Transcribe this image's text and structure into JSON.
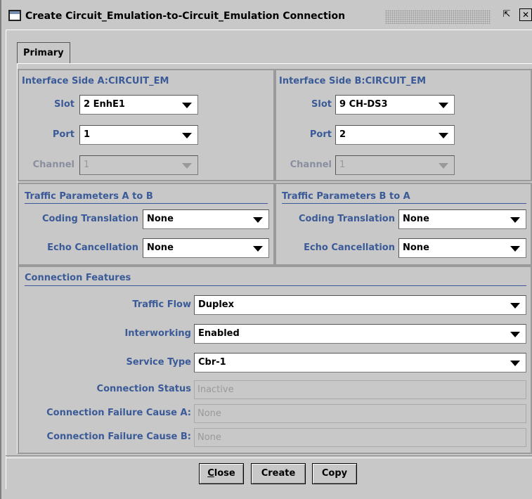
{
  "window": {
    "title": "Create Circuit_Emulation-to-Circuit_Emulation Connection"
  },
  "tabs": [
    {
      "label": "Primary"
    }
  ],
  "side_a": {
    "title": "Interface Side A:CIRCUIT_EM",
    "slot": {
      "label": "Slot",
      "value": "2 EnhE1"
    },
    "port": {
      "label": "Port",
      "value": "1"
    },
    "channel": {
      "label": "Channel",
      "value": "1"
    }
  },
  "side_b": {
    "title": "Interface Side B:CIRCUIT_EM",
    "slot": {
      "label": "Slot",
      "value": "9 CH-DS3"
    },
    "port": {
      "label": "Port",
      "value": "2"
    },
    "channel": {
      "label": "Channel",
      "value": "1"
    }
  },
  "traffic_a_to_b": {
    "title": "Traffic Parameters A to B",
    "coding_translation": {
      "label": "Coding Translation",
      "value": "None"
    },
    "echo_cancellation": {
      "label": "Echo Cancellation",
      "value": "None"
    }
  },
  "traffic_b_to_a": {
    "title": "Traffic Parameters B to A",
    "coding_translation": {
      "label": "Coding Translation",
      "value": "None"
    },
    "echo_cancellation": {
      "label": "Echo Cancellation",
      "value": "None"
    }
  },
  "connection_features": {
    "title": "Connection Features",
    "traffic_flow": {
      "label": "Traffic Flow",
      "value": "Duplex"
    },
    "interworking": {
      "label": "Interworking",
      "value": "Enabled"
    },
    "service_type": {
      "label": "Service Type",
      "value": "Cbr-1"
    },
    "connection_status": {
      "label": "Connection Status",
      "value": "Inactive"
    },
    "failure_cause_a": {
      "label": "Connection Failure Cause A:",
      "value": "None"
    },
    "failure_cause_b": {
      "label": "Connection Failure Cause B:",
      "value": "None"
    }
  },
  "buttons": {
    "close": {
      "prefix": "",
      "mnemonic": "C",
      "rest": "lose"
    },
    "create": "Create",
    "copy": "Copy"
  },
  "colors": {
    "label": "#3a5a98",
    "background": "#c8c8c8"
  }
}
